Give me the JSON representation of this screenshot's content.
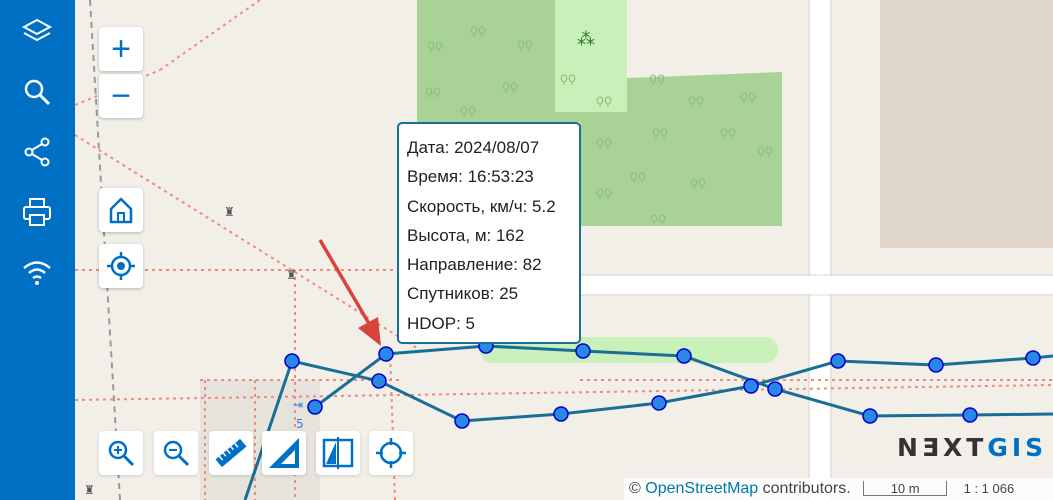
{
  "sidebar": {
    "items": [
      {
        "name": "layers-icon"
      },
      {
        "name": "search-icon"
      },
      {
        "name": "share-icon"
      },
      {
        "name": "print-icon"
      },
      {
        "name": "wifi-icon"
      }
    ]
  },
  "zoom": {
    "in_label": "+",
    "out_label": "−"
  },
  "popup": {
    "rows": [
      "Дата: 2024/08/07",
      "Время: 16:53:23",
      "Скорость, км/ч: 5.2",
      "Высота, м: 162",
      "Направление: 82",
      "Спутников: 25",
      "HDOP: 5"
    ]
  },
  "logo": {
    "main": "NƎXT",
    "accent": "GIS"
  },
  "attribution": {
    "copyright": "©",
    "link_text": "OpenStreetMap",
    "suffix": "contributors."
  },
  "scale": {
    "distance": "10 m",
    "ratio": "1 : 1 066"
  },
  "colors": {
    "sidebar": "#0070c5",
    "track": "#1a6e96",
    "point_fill": "#2b87e5",
    "point_stroke": "#0000cc",
    "arrow": "#d9433b",
    "park": "#a9d396"
  }
}
